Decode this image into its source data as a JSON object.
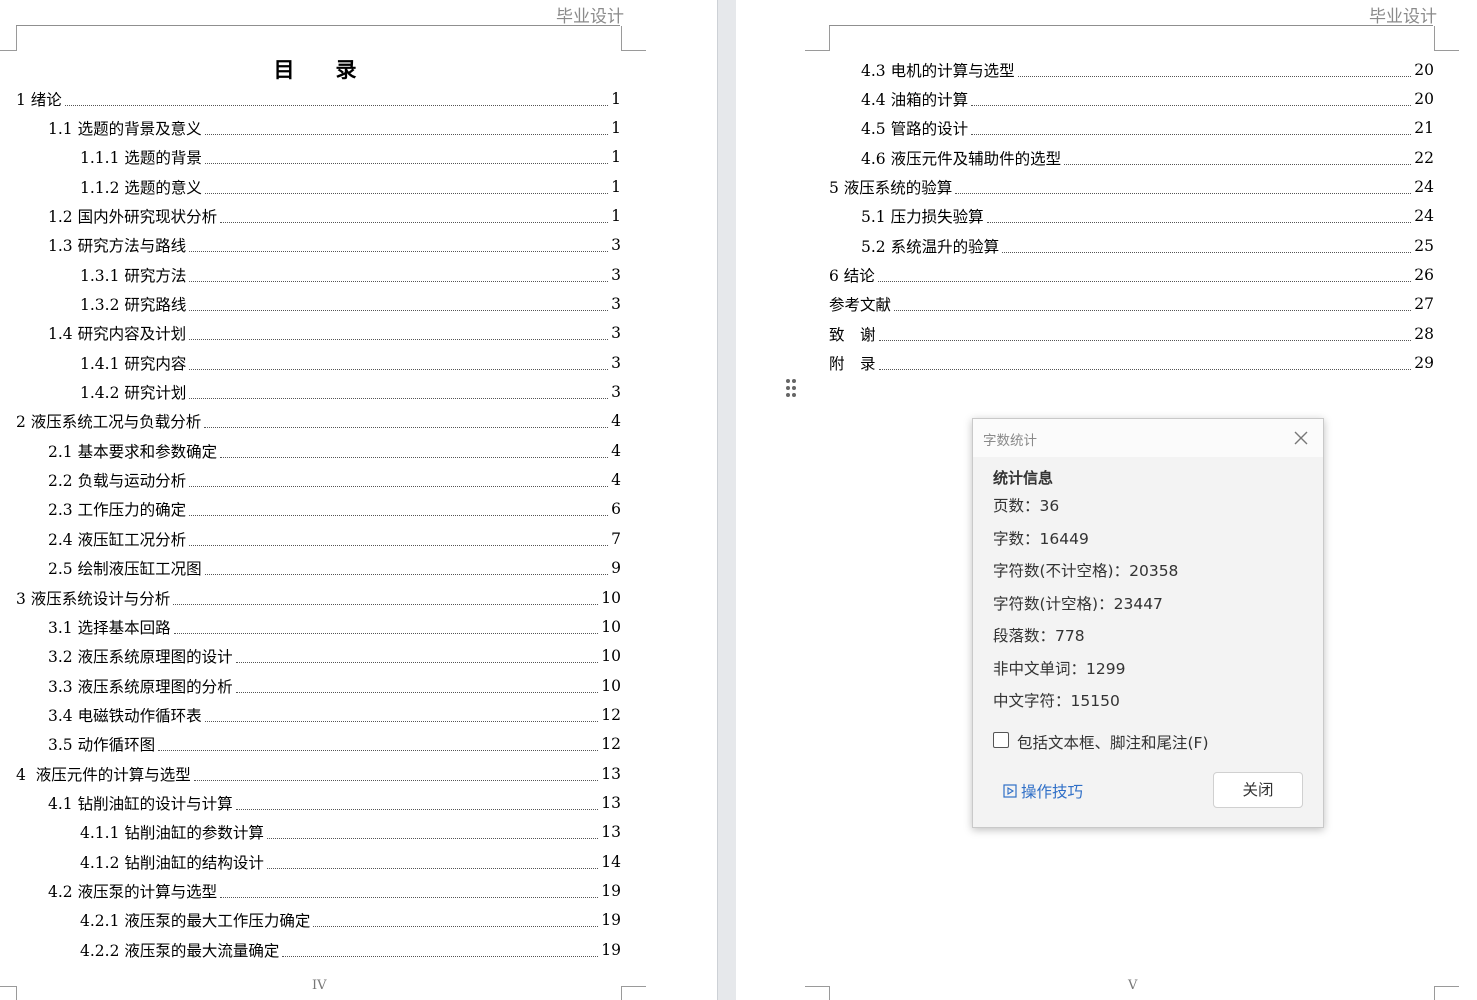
{
  "header": {
    "left_page": "毕业设计",
    "right_page": "毕业设计"
  },
  "toc_title": "目　录",
  "left_entries": [
    {
      "label": "1 绪论",
      "page": "1",
      "level": 0
    },
    {
      "label": "1.1 选题的背景及意义",
      "page": "1",
      "level": 1
    },
    {
      "label": "1.1.1 选题的背景",
      "page": "1",
      "level": 2
    },
    {
      "label": "1.1.2 选题的意义",
      "page": "1",
      "level": 2
    },
    {
      "label": "1.2 国内外研究现状分析",
      "page": "1",
      "level": 1
    },
    {
      "label": "1.3 研究方法与路线",
      "page": "3",
      "level": 1
    },
    {
      "label": "1.3.1 研究方法",
      "page": "3",
      "level": 2
    },
    {
      "label": "1.3.2 研究路线",
      "page": "3",
      "level": 2
    },
    {
      "label": "1.4 研究内容及计划",
      "page": "3",
      "level": 1
    },
    {
      "label": "1.4.1 研究内容",
      "page": "3",
      "level": 2
    },
    {
      "label": "1.4.2 研究计划",
      "page": "3",
      "level": 2
    },
    {
      "label": "2 液压系统工况与负载分析",
      "page": "4",
      "level": 0
    },
    {
      "label": "2.1 基本要求和参数确定",
      "page": "4",
      "level": 1
    },
    {
      "label": "2.2 负载与运动分析",
      "page": "4",
      "level": 1
    },
    {
      "label": "2.3 工作压力的确定",
      "page": "6",
      "level": 1
    },
    {
      "label": "2.4 液压缸工况分析",
      "page": "7",
      "level": 1
    },
    {
      "label": "2.5 绘制液压缸工况图",
      "page": "9",
      "level": 1
    },
    {
      "label": "3 液压系统设计与分析",
      "page": "10",
      "level": 0
    },
    {
      "label": "3.1 选择基本回路",
      "page": "10",
      "level": 1
    },
    {
      "label": "3.2 液压系统原理图的设计",
      "page": "10",
      "level": 1
    },
    {
      "label": "3.3 液压系统原理图的分析",
      "page": "10",
      "level": 1
    },
    {
      "label": "3.4 电磁铁动作循环表",
      "page": "12",
      "level": 1
    },
    {
      "label": "3.5 动作循环图",
      "page": "12",
      "level": 1
    },
    {
      "label": "4  液压元件的计算与选型",
      "page": "13",
      "level": 0
    },
    {
      "label": "4.1 钻削油缸的设计与计算",
      "page": "13",
      "level": 1
    },
    {
      "label": "4.1.1 钻削油缸的参数计算",
      "page": "13",
      "level": 2
    },
    {
      "label": "4.1.2 钻削油缸的结构设计",
      "page": "14",
      "level": 2
    },
    {
      "label": "4.2 液压泵的计算与选型",
      "page": "19",
      "level": 1
    },
    {
      "label": "4.2.1 液压泵的最大工作压力确定",
      "page": "19",
      "level": 2
    },
    {
      "label": "4.2.2 液压泵的最大流量确定",
      "page": "19",
      "level": 2
    }
  ],
  "right_entries": [
    {
      "label": "4.3 电机的计算与选型",
      "page": "20",
      "level": 1
    },
    {
      "label": "4.4 油箱的计算",
      "page": "20",
      "level": 1
    },
    {
      "label": "4.5 管路的设计",
      "page": "21",
      "level": 1
    },
    {
      "label": "4.6 液压元件及辅助件的选型",
      "page": "22",
      "level": 1
    },
    {
      "label": "5 液压系统的验算",
      "page": "24",
      "level": 0
    },
    {
      "label": "5.1 压力损失验算",
      "page": "24",
      "level": 1
    },
    {
      "label": "5.2 系统温升的验算",
      "page": "25",
      "level": 1
    },
    {
      "label": "6 结论",
      "page": "26",
      "level": 0
    },
    {
      "label": "参考文献",
      "page": "27",
      "level": 0
    },
    {
      "label": "致　谢",
      "page": "28",
      "level": 0
    },
    {
      "label": "附　录",
      "page": "29",
      "level": 0
    }
  ],
  "footer": {
    "left_page_num": "IV",
    "right_page_num": "V"
  },
  "dialog": {
    "title": "字数统计",
    "section": "统计信息",
    "stats": [
      {
        "label": "页数：",
        "value": "36"
      },
      {
        "label": "字数：",
        "value": "16449"
      },
      {
        "label": "字符数(不计空格)：",
        "value": "20358"
      },
      {
        "label": "字符数(计空格)：",
        "value": "23447"
      },
      {
        "label": "段落数：",
        "value": "778"
      },
      {
        "label": "非中文单词：",
        "value": "1299"
      },
      {
        "label": "中文字符：",
        "value": "15150"
      }
    ],
    "checkbox_label": "包括文本框、脚注和尾注(F)",
    "checkbox_checked": false,
    "tips_label": "操作技巧",
    "close_label": "关闭"
  }
}
